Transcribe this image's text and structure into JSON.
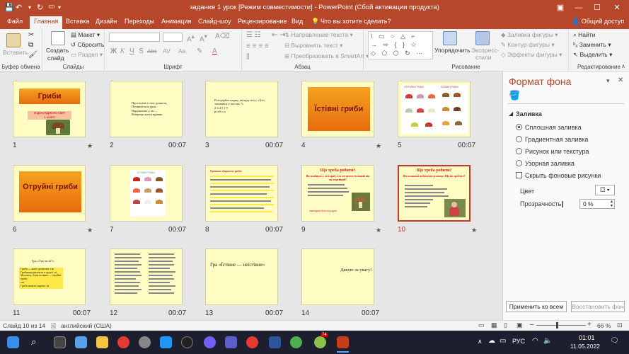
{
  "title_bar": {
    "title": "задание 1 урок [Режим совместимости] - PowerPoint (Сбой активации продукта)"
  },
  "tabs": [
    "Файл",
    "Главная",
    "Вставка",
    "Дизайн",
    "Переходы",
    "Анимация",
    "Слайд-шоу",
    "Рецензирование",
    "Вид"
  ],
  "tell_me": "Что вы хотите сделать?",
  "share": "Общий доступ",
  "ribbon": {
    "clipboard": {
      "label": "Буфер обмена",
      "paste": "Вставить"
    },
    "slides": {
      "label": "Слайды",
      "new_slide": "Создать",
      "new_slide2": "слайд",
      "layout": "Макет",
      "reset": "Сбросить",
      "section": "Раздел"
    },
    "font": {
      "label": "Шрифт",
      "bold": "Ж",
      "italic": "К",
      "underline": "Ч",
      "strike": "S",
      "abc": "abc",
      "spacing": "AV",
      "case": "Aa"
    },
    "paragraph": {
      "label": "Абзац",
      "text_direction": "Направление текста",
      "align_text": "Выровнять текст",
      "smartart": "Преобразовать в SmartArt"
    },
    "drawing": {
      "label": "Рисование",
      "arrange": "Упорядочить",
      "quick_styles": "Экспресс-",
      "quick_styles2": "стили",
      "fill": "Заливка фигуры",
      "outline": "Контур фигуры",
      "effects": "Эффекты фигуры"
    },
    "editing": {
      "label": "Редактирование",
      "find": "Найти",
      "replace": "Заменить",
      "select": "Выделить"
    }
  },
  "slides": [
    {
      "num": "1",
      "title": "Гриби",
      "sub1": "Я ДОСЛІДЖУЮ СВІТ",
      "sub2": "1 класс",
      "time": "",
      "star": "★"
    },
    {
      "num": "2",
      "text": [
        "Прослухав і стих довкола,",
        "Починається урок.",
        "Вирушаємо у ліс –",
        "Вітерець листя правно."
      ],
      "time": "00:07"
    },
    {
      "num": "3",
      "text": [
        "Розгадайте першу загадку пісу: «Хто",
        "заховався у числах ?»",
        "2 3 4 5 1 5",
        "р и б г и"
      ],
      "time": "00:07"
    },
    {
      "num": "4",
      "title": "Їстівні гриби",
      "time": "",
      "star": "★"
    },
    {
      "num": "5",
      "heading1": "ОТРУЙНІ ГРИБИ",
      "heading2": "ЇСТІВНІ ГРИБИ",
      "time": "00:07"
    },
    {
      "num": "6",
      "title": "Отруйні гриби",
      "time": "",
      "star": "★"
    },
    {
      "num": "7",
      "heading": "ЇСТІВНІ ГРИБИ",
      "time": "00:07"
    },
    {
      "num": "8",
      "heading": "Правила збирання грибів",
      "time": "00:07"
    },
    {
      "num": "9",
      "heading1": "Що треба робити?",
      "heading2": "Ви знайшли у лісі гриб, але не знаєте їстівний він чи отруйний?",
      "caption": "знаходьте його на рідно",
      "time": "00:07",
      "star": "★"
    },
    {
      "num": "10",
      "heading1": "Що треба робити?",
      "heading2": "На галявині побачили мухомор. Що ви зробите?",
      "time": "",
      "star": "★"
    },
    {
      "num": "11",
      "heading": "Гра «Так чи ні?»",
      "text": [
        "Гриби — живі організми: так",
        "Грибниця кріпиться в ґрунті: ні",
        "Мухомор, бліда поганка — отруйні гриби",
        "так",
        "Гриби живуть окремо: ні"
      ],
      "time": "00:07"
    },
    {
      "num": "12",
      "time": "00:07"
    },
    {
      "num": "13",
      "text": [
        "Гра «Їстівне — неїстівне»"
      ],
      "time": "00:07"
    },
    {
      "num": "14",
      "text": [
        "Дякую за увагу!"
      ],
      "time": "00:07"
    }
  ],
  "format_pane": {
    "title": "Формат фона",
    "section": "Заливка",
    "options": [
      "Сплошная заливка",
      "Градиентная заливка",
      "Рисунок или текстура",
      "Узорная заливка"
    ],
    "hide_bg": "Скрыть фоновые рисунки",
    "color_label": "Цвет",
    "transparency_label": "Прозрачность",
    "transparency_value": "0 %",
    "apply_all": "Применить ко всем",
    "reset_bg": "Восстановить фон"
  },
  "status": {
    "slide_info": "Слайд 10 из 14",
    "language": "английский (США)",
    "zoom": "66 %"
  },
  "taskbar": {
    "lang": "РУС",
    "time": "01:01",
    "date": "11.05.2022",
    "badge": "74"
  }
}
